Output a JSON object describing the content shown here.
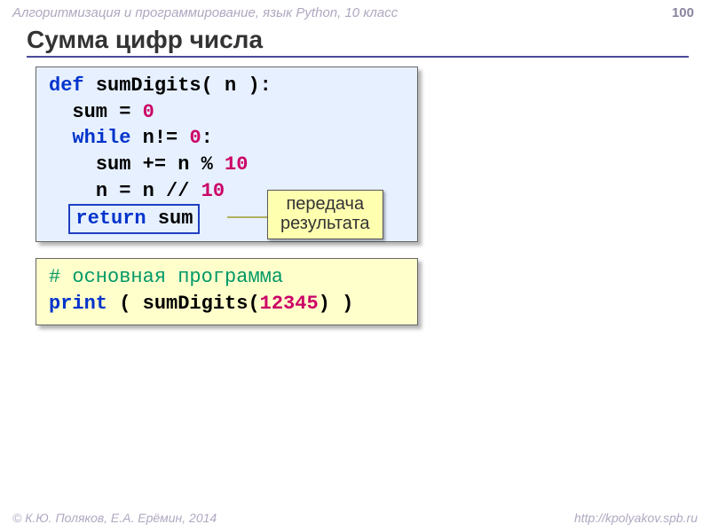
{
  "header": {
    "course": "Алгоритмизация и программирование, язык Python, 10 класс",
    "page": "100"
  },
  "title": "Сумма цифр числа",
  "code1": {
    "l1_def": "def",
    "l1_name": "sumDigits( n ):",
    "l2_a": "sum =",
    "l2_b": "0",
    "l3_a": "while",
    "l3_b": "n!=",
    "l3_c": "0",
    "l3_d": ":",
    "l4_a": "sum += n %",
    "l4_b": "10",
    "l5_a": "n = n //",
    "l5_b": "10",
    "l6_a": "return",
    "l6_b": "sum"
  },
  "callout": {
    "line1": "передача",
    "line2": "результата"
  },
  "code2": {
    "l1_hash": "#",
    "l1_cmt": "основная программа",
    "l2_a": "print",
    "l2_b": "( sumDigits(",
    "l2_c": "12345",
    "l2_d": ") )"
  },
  "footer": {
    "left": "© К.Ю. Поляков, Е.А. Ерёмин, 2014",
    "right": "http://kpolyakov.spb.ru"
  }
}
